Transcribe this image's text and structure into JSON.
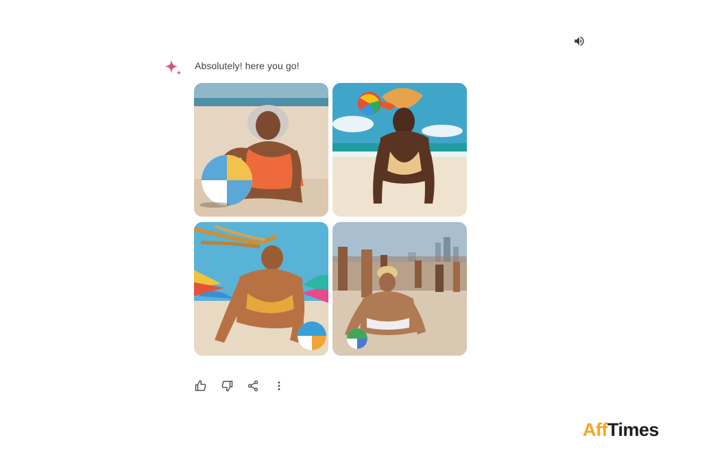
{
  "message": {
    "text": "Absolutely! here you go!"
  },
  "images": [
    {
      "alt": "Generated image 1"
    },
    {
      "alt": "Generated image 2"
    },
    {
      "alt": "Generated image 3"
    },
    {
      "alt": "Generated image 4"
    }
  ],
  "actions": [
    {
      "icon": "thumbs-up-icon"
    },
    {
      "icon": "thumbs-down-icon"
    },
    {
      "icon": "share-icon"
    },
    {
      "icon": "more-vertical-icon"
    }
  ],
  "watermark": {
    "part1": "Aff",
    "part2": "Times"
  },
  "colors": {
    "sparkle": "#d9537a",
    "text": "#3c4043",
    "logo_accent": "#f5a623",
    "logo_dark": "#1d1d1b"
  }
}
